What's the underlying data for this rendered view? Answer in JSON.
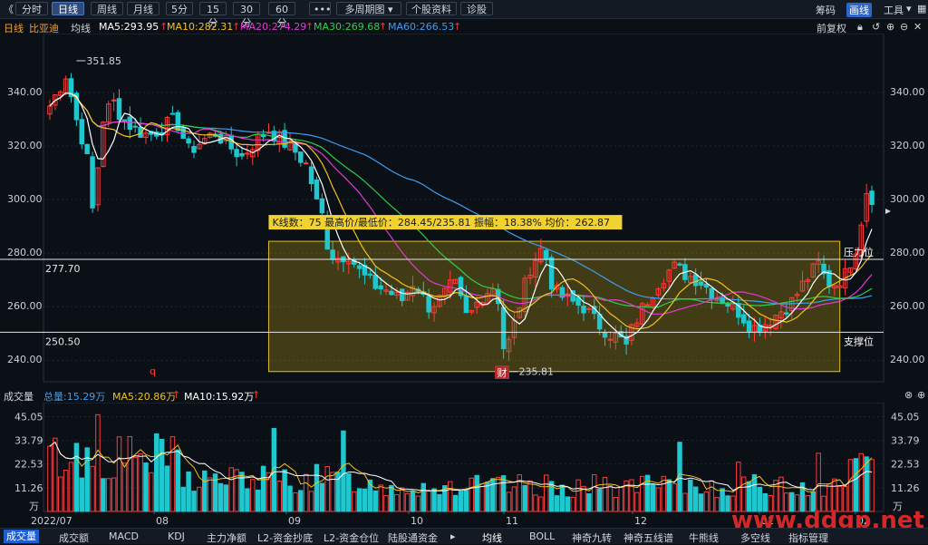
{
  "toolbar": {
    "back": "《",
    "buttons": [
      "分时",
      "日线",
      "周线",
      "月线",
      "5分",
      "15分",
      "30分",
      "60分",
      "•••",
      "多周期图",
      "个股资料",
      "诊股"
    ],
    "active": "日线",
    "right": [
      "筹码",
      "画线",
      "工具"
    ],
    "right_active": "画线"
  },
  "legend": {
    "period": "日线",
    "stock": "比亚迪",
    "mode": "均线",
    "ma5": "MA5:293.95",
    "ma10": "MA10:282.31",
    "ma20": "MA20:274.29",
    "ma30": "MA30:269.68",
    "ma60": "MA60:266.53",
    "adjust": "前复权",
    "colors": {
      "ma5": "#ffffff",
      "ma10": "#f0c21d",
      "ma20": "#e23ad2",
      "ma30": "#2fcf4a",
      "ma60": "#3d9ef0"
    }
  },
  "chart_data": {
    "type": "candlestick",
    "price_axis": {
      "ticks": [
        "340.00",
        "320.00",
        "300.00",
        "280.00",
        "260.00",
        "240.00"
      ],
      "range": [
        232,
        362
      ]
    },
    "max_label": "351.85",
    "min_label": "235.81",
    "resistance": {
      "value": 277.7,
      "label": "277.70",
      "text": "压力位"
    },
    "support": {
      "value": 250.5,
      "label": "250.50",
      "text": "支撑位"
    },
    "range_box": {
      "info": "K线数：75 最高价/最低价：284.45/235.81 振幅：18.38% 均价：262.87"
    },
    "marker_q": "q",
    "marker_cai": "财",
    "x_labels": [
      "2022/07",
      "08",
      "09",
      "10",
      "11",
      "12",
      "01",
      "02"
    ],
    "candles_count": 155,
    "volume": {
      "header_label": "成交量",
      "total": "总量:15.29万",
      "ma5": "MA5:20.86万",
      "ma10": "MA10:15.92万",
      "ticks": [
        "45.05",
        "33.79",
        "22.53",
        "11.26",
        "万"
      ]
    }
  },
  "tabs": [
    "成交量",
    "成交额",
    "MACD",
    "KDJ",
    "主力净额",
    "L2-资金抄底",
    "L2-资金仓位",
    "陆股通资金",
    "均线",
    "BOLL",
    "神奇九转",
    "神奇五线谱",
    "牛熊线",
    "多空线",
    "指标管理"
  ],
  "tab_active": "成交量",
  "tab_active2": "均线",
  "watermark": "www.ddgp.net"
}
